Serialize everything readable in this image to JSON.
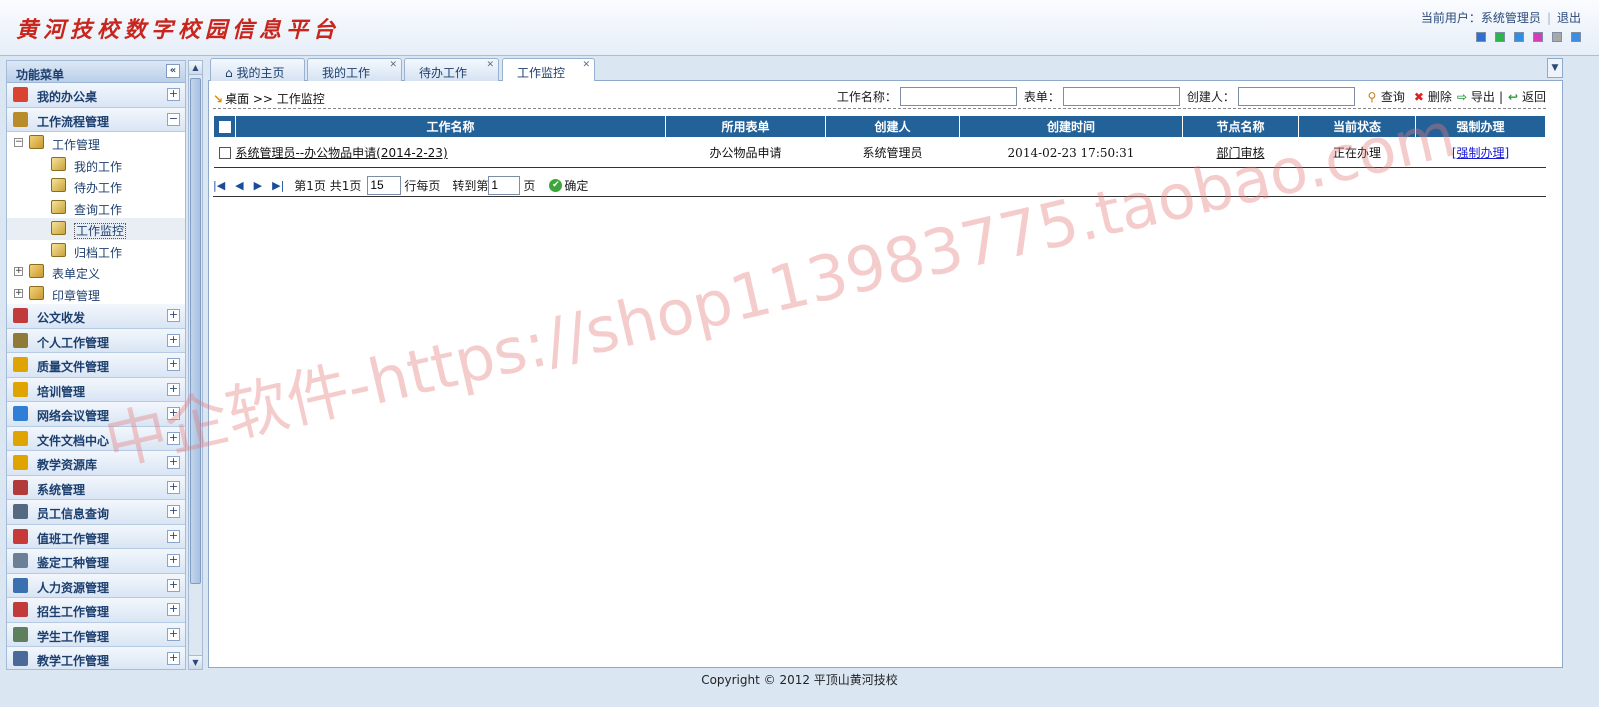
{
  "header": {
    "title": "黄河技校数字校园信息平台",
    "current_user_label": "当前用户：系统管理员",
    "logout": "退出",
    "skin_colors": [
      "#2f6fd1",
      "#2bb54a",
      "#2f8ee6",
      "#d43fb3",
      "#a8a8a8",
      "#3c8ee0"
    ]
  },
  "sidebar": {
    "title": "功能菜单",
    "collapse_icon": "double-chevron-left-icon",
    "groups_top": [
      {
        "label": "我的办公桌",
        "expanded": false,
        "icon_color": "#d9432f"
      },
      {
        "label": "工作流程管理",
        "expanded": true,
        "icon_color": "#b98b2a"
      }
    ],
    "tree": [
      {
        "label": "工作管理",
        "level": 1,
        "toggle": "−",
        "selected": false
      },
      {
        "label": "我的工作",
        "level": 2,
        "selected": false
      },
      {
        "label": "待办工作",
        "level": 2,
        "selected": false
      },
      {
        "label": "查询工作",
        "level": 2,
        "selected": false
      },
      {
        "label": "工作监控",
        "level": 2,
        "selected": true
      },
      {
        "label": "归档工作",
        "level": 2,
        "selected": false
      },
      {
        "label": "表单定义",
        "level": 1,
        "toggle": "+",
        "selected": false
      },
      {
        "label": "印章管理",
        "level": 1,
        "toggle": "+",
        "selected": false
      }
    ],
    "groups_bottom": [
      {
        "label": "公文收发",
        "icon_color": "#c23b3b"
      },
      {
        "label": "个人工作管理",
        "icon_color": "#8f7a3a"
      },
      {
        "label": "质量文件管理",
        "icon_color": "#e0a400"
      },
      {
        "label": "培训管理",
        "icon_color": "#e0a400"
      },
      {
        "label": "网络会议管理",
        "icon_color": "#2f7fd6"
      },
      {
        "label": "文件文档中心",
        "icon_color": "#e0a400"
      },
      {
        "label": "教学资源库",
        "icon_color": "#e0a400"
      },
      {
        "label": "系统管理",
        "icon_color": "#b23a3a"
      },
      {
        "label": "员工信息查询",
        "icon_color": "#556a80"
      },
      {
        "label": "值班工作管理",
        "icon_color": "#c83a3a"
      },
      {
        "label": "鉴定工种管理",
        "icon_color": "#6b7f96"
      },
      {
        "label": "人力资源管理",
        "icon_color": "#3a6fb0"
      },
      {
        "label": "招生工作管理",
        "icon_color": "#c23b3b"
      },
      {
        "label": "学生工作管理",
        "icon_color": "#5d7f5d"
      },
      {
        "label": "教学工作管理",
        "icon_color": "#4a6a9a"
      }
    ]
  },
  "tabs": [
    {
      "label": "我的主页",
      "icon": "home-icon",
      "active": false,
      "closable": false
    },
    {
      "label": "我的工作",
      "active": false,
      "closable": true
    },
    {
      "label": "待办工作",
      "active": false,
      "closable": true
    },
    {
      "label": "工作监控",
      "active": true,
      "closable": true
    }
  ],
  "toolbar": {
    "breadcrumb": "桌面 >> 工作监控",
    "work_name_label": "工作名称：",
    "work_name_value": "",
    "form_label": "表单：",
    "form_value": "",
    "creator_label": "创建人：",
    "creator_value": "",
    "search": "查询",
    "delete": "删除",
    "export": "导出",
    "back": "返回"
  },
  "table": {
    "columns": [
      "工作名称",
      "所用表单",
      "创建人",
      "创建时间",
      "节点名称",
      "当前状态",
      "强制办理"
    ],
    "rows": [
      {
        "name": "系统管理员--办公物品申请(2014-2-23)",
        "form": "办公物品申请",
        "creator": "系统管理员",
        "created": "2014-02-23 17:50:31",
        "node": "部门审核",
        "status": "正在办理",
        "action": "[强制办理]"
      }
    ]
  },
  "pager": {
    "page_info": "第1页 共1页",
    "page_size": "15",
    "rows_per_page": "行每页",
    "goto_label": "转到第",
    "goto_value": "1",
    "page_unit": "页",
    "confirm": "确定"
  },
  "watermark": "中企软件-https://shop113983775.taobao.com",
  "footer": "Copyright © 2012 平顶山黄河技校"
}
